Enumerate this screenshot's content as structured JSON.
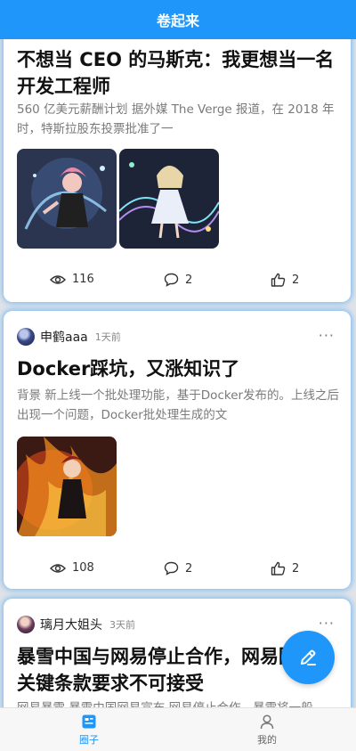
{
  "header": {
    "title": "卷起来"
  },
  "posts": [
    {
      "author": "",
      "time": "",
      "title": "不想当 CEO 的马斯克：我更想当一名开发工程师",
      "excerpt": "560 亿美元薪酬计划 据外媒 The Verge 报道，在 2018 年时，特斯拉股东投票批准了一",
      "views": "116",
      "comments": "2",
      "likes": "2"
    },
    {
      "author": "申鹤aaa",
      "time": "1天前",
      "title": "Docker踩坑，又涨知识了",
      "excerpt": "背景 新上线一个批处理功能，基于Docker发布的。上线之后出现一个问题，Docker批处理生成的文",
      "views": "108",
      "comments": "2",
      "likes": "2"
    },
    {
      "author": "璃月大姐头",
      "time": "3天前",
      "title": "暴雪中国与网易停止合作，网易回应：关键条款要求不可接受",
      "excerpt": "网易暴雪 暴雪中国网易宣布 网易停止合作，暴雪将一般"
    }
  ],
  "more_glyph": "···",
  "tabbar": {
    "items": [
      {
        "label": "圈子",
        "icon": "feed-icon",
        "active": true
      },
      {
        "label": "我的",
        "icon": "user-icon",
        "active": false
      }
    ]
  },
  "colors": {
    "brand": "#1e96fa"
  }
}
